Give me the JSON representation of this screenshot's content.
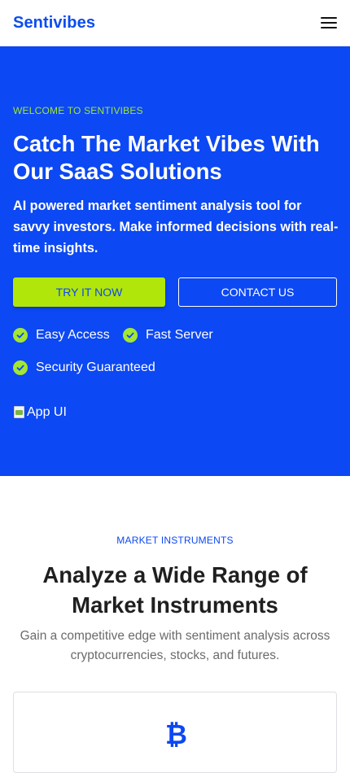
{
  "header": {
    "brand": "Sentivibes",
    "menu_icon": "hamburger-menu-icon"
  },
  "hero": {
    "eyebrow": "WELCOME TO SENTIVIBES",
    "title": "Catch The Market Vibes With Our SaaS Solutions",
    "subtitle": "AI powered market sentiment analysis tool for savvy investors. Make informed decisions with real-time insights.",
    "primary_button": "TRY IT NOW",
    "secondary_button": "CONTACT US",
    "features": [
      "Easy Access",
      "Fast Server",
      "Security Guaranteed"
    ],
    "image_alt": "App UI"
  },
  "instruments": {
    "eyebrow": "MARKET INSTRUMENTS",
    "title": "Analyze a Wide Range of Market Instruments",
    "subtitle": "Gain a competitive edge with sentiment analysis across cryptocurrencies, stocks, and futures.",
    "card_icon": "bitcoin-icon",
    "card_icon_glyph": "₿"
  },
  "colors": {
    "brand_blue": "#0c48f3",
    "accent_lime": "#b1e60b",
    "check_green": "#a3e635"
  }
}
